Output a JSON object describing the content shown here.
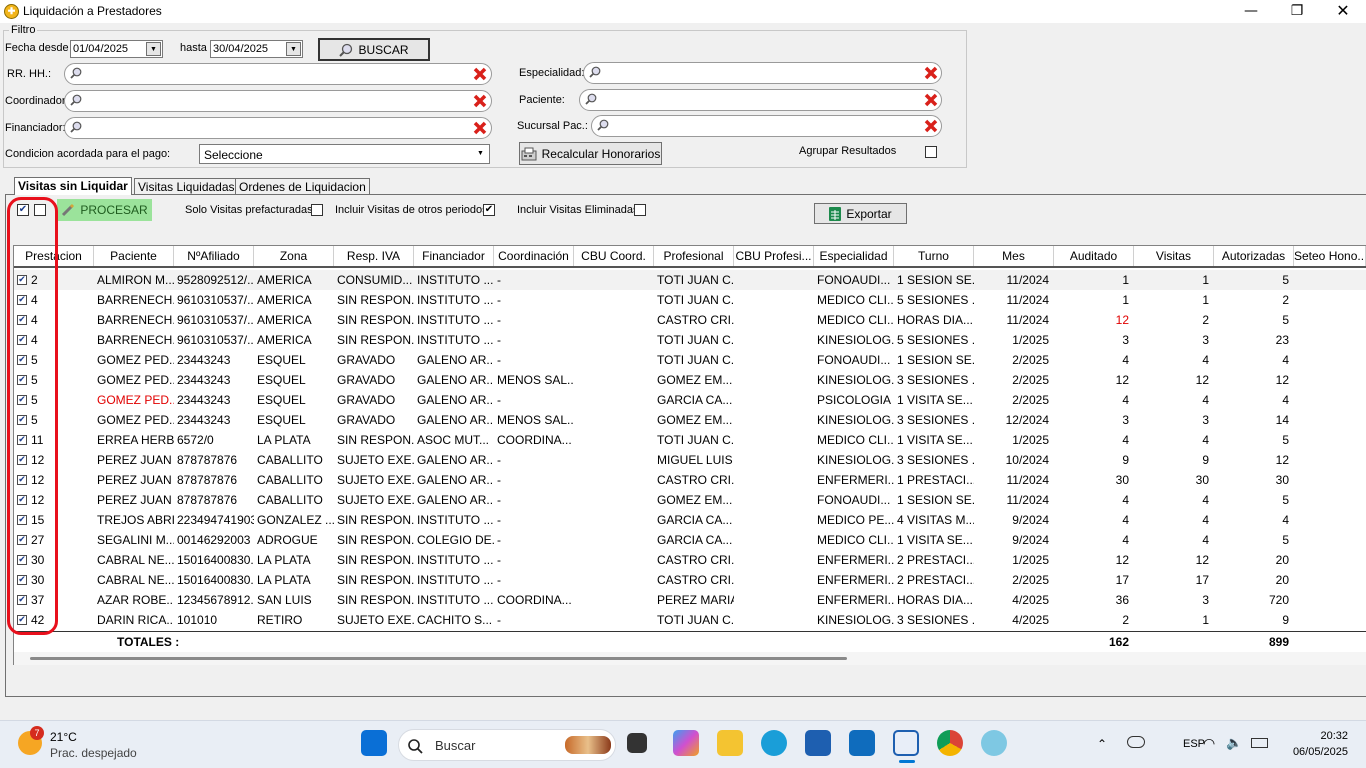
{
  "window": {
    "title": "Liquidación a Prestadores",
    "icon": "app-logo-icon",
    "controls": {
      "minimize": "—",
      "maximize": "❐",
      "close": "✕"
    }
  },
  "filter": {
    "legend": "Filtro",
    "fecha_desde_label": "Fecha desde",
    "fecha_desde": "01/04/2025",
    "hasta_label": "hasta",
    "hasta": "30/04/2025",
    "buscar_label": "BUSCAR",
    "rrhh_label": "RR. HH.:",
    "coordinador_label": "Coordinador:",
    "financiador_label": "Financiador:",
    "especialidad_label": "Especialidad:",
    "paciente_label": "Paciente:",
    "sucursal_label": "Sucursal Pac.:",
    "condicion_label": "Condicion acordada para el pago:",
    "condicion_value": "Seleccione",
    "recalcular_label": "Recalcular Honorarios",
    "agrupar_label": "Agrupar Resultados"
  },
  "tabs": [
    {
      "label": "Visitas sin Liquidar",
      "active": true
    },
    {
      "label": "Visitas Liquidadas",
      "active": false
    },
    {
      "label": "Ordenes de Liquidacion",
      "active": false
    }
  ],
  "toolbar": {
    "procesar_label": "PROCESAR",
    "solo_prefacturadas_label": "Solo Visitas prefacturadas",
    "incluir_otros_label": "Incluir Visitas de otros periodos",
    "incluir_eliminadas_label": "Incluir Visitas Eliminadas",
    "exportar_label": "Exportar"
  },
  "columns": [
    "Prestacion",
    "Paciente",
    "NºAfiliado",
    "Zona",
    "Resp. IVA",
    "Financiador",
    "Coordinación",
    "CBU Coord.",
    "Profesional",
    "CBU Profesi...",
    "Especialidad",
    "Turno",
    "Mes",
    "Auditado",
    "Visitas",
    "Autorizadas",
    "Seteo Hono..."
  ],
  "rows": [
    {
      "prestacion": "2",
      "paciente": "ALMIRON M...",
      "afiliado": "9528092512/...",
      "zona": "AMERICA",
      "iva": "CONSUMID...",
      "financiador": "INSTITUTO ...",
      "coordinacion": "-",
      "cbu_coord": "",
      "profesional": "TOTI JUAN C...",
      "cbu_prof": "",
      "especialidad": "FONOAUDI...",
      "turno": "1 SESION SE...",
      "mes": "11/2024",
      "auditado": "1",
      "visitas": "1",
      "autorizadas": "5",
      "highlight": "",
      "red_field": ""
    },
    {
      "prestacion": "4",
      "paciente": "BARRENECH...",
      "afiliado": "9610310537/...",
      "zona": "AMERICA",
      "iva": "SIN RESPON...",
      "financiador": "INSTITUTO ...",
      "coordinacion": "-",
      "cbu_coord": "",
      "profesional": "TOTI JUAN C...",
      "cbu_prof": "",
      "especialidad": "MEDICO CLI...",
      "turno": "5 SESIONES ...",
      "mes": "11/2024",
      "auditado": "1",
      "visitas": "1",
      "autorizadas": "2",
      "highlight": "",
      "red_field": ""
    },
    {
      "prestacion": "4",
      "paciente": "BARRENECH...",
      "afiliado": "9610310537/...",
      "zona": "AMERICA",
      "iva": "SIN RESPON...",
      "financiador": "INSTITUTO ...",
      "coordinacion": "-",
      "cbu_coord": "",
      "profesional": "CASTRO CRI...",
      "cbu_prof": "",
      "especialidad": "MEDICO CLI...",
      "turno": "HORAS DIA...",
      "mes": "11/2024",
      "auditado": "12",
      "visitas": "2",
      "autorizadas": "5",
      "highlight": "",
      "red_field": "auditado"
    },
    {
      "prestacion": "4",
      "paciente": "BARRENECH...",
      "afiliado": "9610310537/...",
      "zona": "AMERICA",
      "iva": "SIN RESPON...",
      "financiador": "INSTITUTO ...",
      "coordinacion": "-",
      "cbu_coord": "",
      "profesional": "TOTI JUAN C...",
      "cbu_prof": "",
      "especialidad": "KINESIOLOG...",
      "turno": "5 SESIONES ...",
      "mes": "1/2025",
      "auditado": "3",
      "visitas": "3",
      "autorizadas": "23",
      "highlight": "",
      "red_field": ""
    },
    {
      "prestacion": "5",
      "paciente": "GOMEZ PED...",
      "afiliado": "23443243",
      "zona": "ESQUEL",
      "iva": "GRAVADO",
      "financiador": "GALENO AR...",
      "coordinacion": "-",
      "cbu_coord": "",
      "profesional": "TOTI JUAN C...",
      "cbu_prof": "",
      "especialidad": "FONOAUDI...",
      "turno": "1 SESION SE...",
      "mes": "2/2025",
      "auditado": "4",
      "visitas": "4",
      "autorizadas": "4",
      "highlight": "",
      "red_field": ""
    },
    {
      "prestacion": "5",
      "paciente": "GOMEZ PED...",
      "afiliado": "23443243",
      "zona": "ESQUEL",
      "iva": "GRAVADO",
      "financiador": "GALENO AR...",
      "coordinacion": "MENOS SAL...",
      "cbu_coord": "",
      "profesional": "GOMEZ EM...",
      "cbu_prof": "",
      "especialidad": "KINESIOLOG...",
      "turno": "3 SESIONES ...",
      "mes": "2/2025",
      "auditado": "12",
      "visitas": "12",
      "autorizadas": "12",
      "highlight": "",
      "red_field": ""
    },
    {
      "prestacion": "5",
      "paciente": "GOMEZ PED...",
      "afiliado": "23443243",
      "zona": "ESQUEL",
      "iva": "GRAVADO",
      "financiador": "GALENO AR...",
      "coordinacion": "-",
      "cbu_coord": "",
      "profesional": "GARCIA CA...",
      "cbu_prof": "",
      "especialidad": "PSICOLOGIA",
      "turno": "1 VISITA SE...",
      "mes": "2/2025",
      "auditado": "4",
      "visitas": "4",
      "autorizadas": "4",
      "highlight": "",
      "red_field": "paciente"
    },
    {
      "prestacion": "5",
      "paciente": "GOMEZ PED...",
      "afiliado": "23443243",
      "zona": "ESQUEL",
      "iva": "GRAVADO",
      "financiador": "GALENO AR...",
      "coordinacion": "MENOS SAL...",
      "cbu_coord": "",
      "profesional": "GOMEZ EM...",
      "cbu_prof": "",
      "especialidad": "KINESIOLOG...",
      "turno": "3 SESIONES ...",
      "mes": "12/2024",
      "auditado": "3",
      "visitas": "3",
      "autorizadas": "14",
      "highlight": "",
      "red_field": ""
    },
    {
      "prestacion": "11",
      "paciente": "ERREA HERB...",
      "afiliado": "6572/0",
      "zona": "LA PLATA",
      "iva": "SIN RESPON...",
      "financiador": "ASOC MUT...",
      "coordinacion": "COORDINA...",
      "cbu_coord": "",
      "profesional": "TOTI JUAN C...",
      "cbu_prof": "",
      "especialidad": "MEDICO CLI...",
      "turno": "1 VISITA SE...",
      "mes": "1/2025",
      "auditado": "4",
      "visitas": "4",
      "autorizadas": "5",
      "highlight": "",
      "red_field": ""
    },
    {
      "prestacion": "12",
      "paciente": "PEREZ JUAN",
      "afiliado": "878787876",
      "zona": "CABALLITO",
      "iva": "SUJETO EXE...",
      "financiador": "GALENO AR...",
      "coordinacion": "-",
      "cbu_coord": "",
      "profesional": "MIGUEL LUIS",
      "cbu_prof": "",
      "especialidad": "KINESIOLOG...",
      "turno": "3 SESIONES ...",
      "mes": "10/2024",
      "auditado": "9",
      "visitas": "9",
      "autorizadas": "12",
      "highlight": "",
      "red_field": ""
    },
    {
      "prestacion": "12",
      "paciente": "PEREZ JUAN",
      "afiliado": "878787876",
      "zona": "CABALLITO",
      "iva": "SUJETO EXE...",
      "financiador": "GALENO AR...",
      "coordinacion": "-",
      "cbu_coord": "",
      "profesional": "CASTRO CRI...",
      "cbu_prof": "",
      "especialidad": "ENFERMERI...",
      "turno": "1 PRESTACI...",
      "mes": "11/2024",
      "auditado": "30",
      "visitas": "30",
      "autorizadas": "30",
      "highlight": "",
      "red_field": ""
    },
    {
      "prestacion": "12",
      "paciente": "PEREZ JUAN",
      "afiliado": "878787876",
      "zona": "CABALLITO",
      "iva": "SUJETO EXE...",
      "financiador": "GALENO AR...",
      "coordinacion": "-",
      "cbu_coord": "",
      "profesional": "GOMEZ EM...",
      "cbu_prof": "",
      "especialidad": "FONOAUDI...",
      "turno": "1 SESION SE...",
      "mes": "11/2024",
      "auditado": "4",
      "visitas": "4",
      "autorizadas": "5",
      "highlight": "",
      "red_field": ""
    },
    {
      "prestacion": "15",
      "paciente": "TREJOS ABRI...",
      "afiliado": "223494741903",
      "zona": "GONZALEZ ...",
      "iva": "SIN RESPON...",
      "financiador": "INSTITUTO ...",
      "coordinacion": "-",
      "cbu_coord": "",
      "profesional": "GARCIA CA...",
      "cbu_prof": "",
      "especialidad": "MEDICO PE...",
      "turno": "4 VISITAS M...",
      "mes": "9/2024",
      "auditado": "4",
      "visitas": "4",
      "autorizadas": "4",
      "highlight": "",
      "red_field": ""
    },
    {
      "prestacion": "27",
      "paciente": "SEGALINI M...",
      "afiliado": "00146292003",
      "zona": "ADROGUE",
      "iva": "SIN RESPON...",
      "financiador": "COLEGIO DE...",
      "coordinacion": "-",
      "cbu_coord": "",
      "profesional": "GARCIA CA...",
      "cbu_prof": "",
      "especialidad": "MEDICO CLI...",
      "turno": "1 VISITA SE...",
      "mes": "9/2024",
      "auditado": "4",
      "visitas": "4",
      "autorizadas": "5",
      "highlight": "",
      "red_field": ""
    },
    {
      "prestacion": "30",
      "paciente": "CABRAL NE...",
      "afiliado": "15016400830...",
      "zona": "LA PLATA",
      "iva": "SIN RESPON...",
      "financiador": "INSTITUTO ...",
      "coordinacion": "-",
      "cbu_coord": "",
      "profesional": "CASTRO CRI...",
      "cbu_prof": "",
      "especialidad": "ENFERMERI...",
      "turno": "2 PRESTACI...",
      "mes": "1/2025",
      "auditado": "12",
      "visitas": "12",
      "autorizadas": "20",
      "highlight": "",
      "red_field": ""
    },
    {
      "prestacion": "30",
      "paciente": "CABRAL NE...",
      "afiliado": "15016400830...",
      "zona": "LA PLATA",
      "iva": "SIN RESPON...",
      "financiador": "INSTITUTO ...",
      "coordinacion": "-",
      "cbu_coord": "",
      "profesional": "CASTRO CRI...",
      "cbu_prof": "",
      "especialidad": "ENFERMERI...",
      "turno": "2 PRESTACI...",
      "mes": "2/2025",
      "auditado": "17",
      "visitas": "17",
      "autorizadas": "20",
      "highlight": "",
      "red_field": ""
    },
    {
      "prestacion": "37",
      "paciente": "AZAR ROBE...",
      "afiliado": "12345678912...",
      "zona": "SAN LUIS",
      "iva": "SIN RESPON...",
      "financiador": "INSTITUTO ...",
      "coordinacion": "COORDINA...",
      "cbu_coord": "",
      "profesional": "PEREZ MARIA",
      "cbu_prof": "",
      "especialidad": "ENFERMERI...",
      "turno": "HORAS DIA...",
      "mes": "4/2025",
      "auditado": "36",
      "visitas": "3",
      "autorizadas": "720",
      "highlight": "",
      "red_field": ""
    },
    {
      "prestacion": "42",
      "paciente": "DARIN RICA...",
      "afiliado": "101010",
      "zona": "RETIRO",
      "iva": "SUJETO EXE...",
      "financiador": "CACHITO S...",
      "coordinacion": "-",
      "cbu_coord": "",
      "profesional": "TOTI JUAN C...",
      "cbu_prof": "",
      "especialidad": "KINESIOLOG...",
      "turno": "3 SESIONES ...",
      "mes": "4/2025",
      "auditado": "2",
      "visitas": "1",
      "autorizadas": "9",
      "highlight": "",
      "red_field": ""
    }
  ],
  "totals": {
    "label": "TOTALES :",
    "visitas": "162",
    "autorizadas": "899"
  },
  "taskbar": {
    "weather_temp": "21°C",
    "weather_desc": "Prac. despejado",
    "weather_badge": "7",
    "search_placeholder": "Buscar",
    "lang": "ESP",
    "time": "20:32",
    "date": "06/05/2025"
  },
  "colors": {
    "accent": "#0078d4",
    "red_text": "#e00000",
    "annotation": "#e8101c",
    "procesar_bg": "#9be39b"
  }
}
